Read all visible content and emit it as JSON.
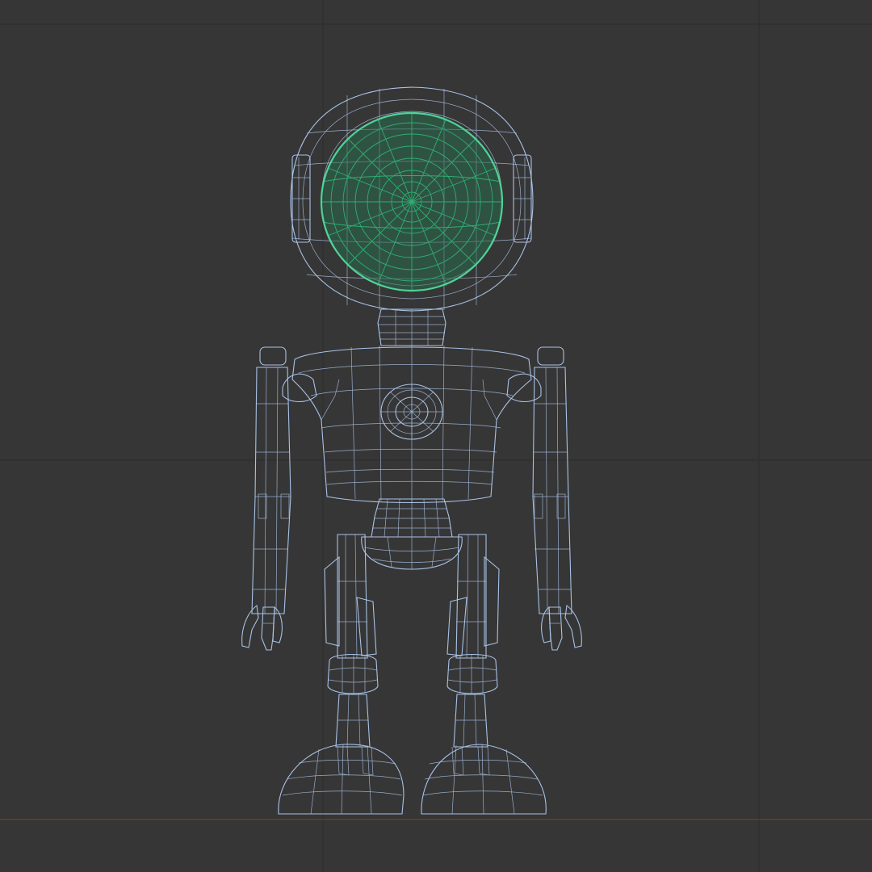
{
  "viewport": {
    "mode": "wireframe",
    "background_color": "#363636",
    "grid_color": "#2e2e2e",
    "ground_axis_color": "#6b4a34",
    "wire_color": "#a9c2e6",
    "selected_wire_color": "#2fae73"
  },
  "model": {
    "parts": [
      "head",
      "face-visor",
      "ear-left",
      "ear-right",
      "neck",
      "torso",
      "chest-emblem",
      "waist",
      "pelvis",
      "arm-left",
      "arm-right",
      "hand-left",
      "hand-right",
      "leg-left",
      "leg-right",
      "knee-left",
      "knee-right",
      "foot-left",
      "foot-right"
    ],
    "selected_part": "face-visor"
  }
}
